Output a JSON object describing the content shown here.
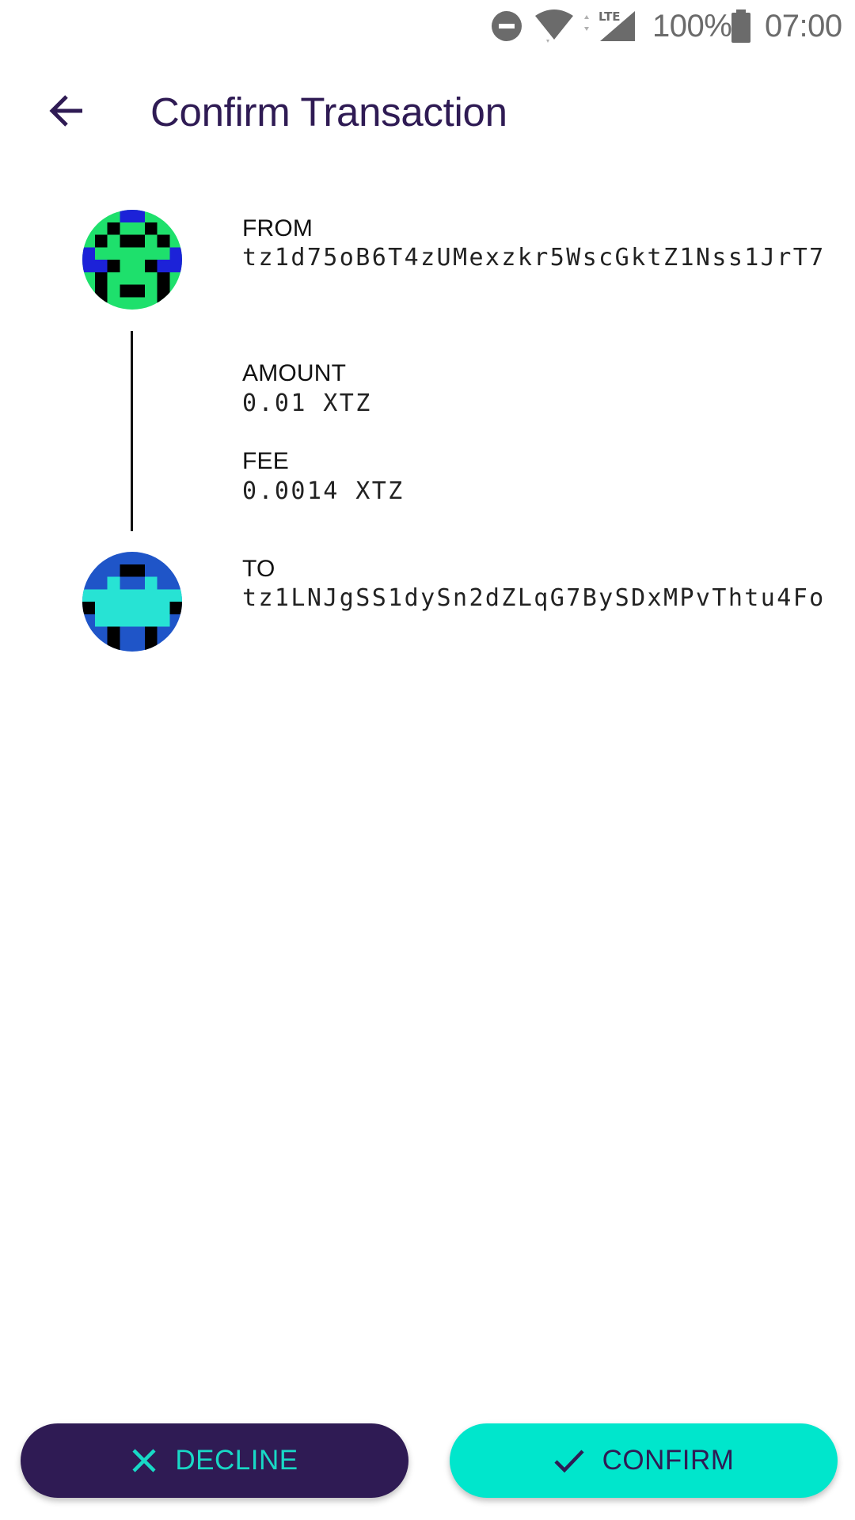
{
  "status_bar": {
    "battery_percent": "100%",
    "time": "07:00",
    "network_type": "LTE",
    "icons": [
      "do-not-disturb-icon",
      "wifi-icon",
      "lte-signal-icon",
      "battery-icon"
    ]
  },
  "app_bar": {
    "title": "Confirm Transaction",
    "back_icon": "arrow-back-icon"
  },
  "transaction": {
    "from": {
      "label": "FROM",
      "address": "tz1d75oB6T4zUMexzkr5WscGktZ1Nss1JrT7",
      "avatar_colors": [
        "#1ee06c",
        "#1c22d8",
        "#000000"
      ]
    },
    "amount": {
      "label": "AMOUNT",
      "value": "0.01 XTZ"
    },
    "fee": {
      "label": "FEE",
      "value": "0.0014 XTZ"
    },
    "to": {
      "label": "TO",
      "address": "tz1LNJgSS1dySn2dZLqG7BySDxMPvThtu4Fo",
      "avatar_colors": [
        "#1f55c8",
        "#27e3d4",
        "#000000"
      ]
    }
  },
  "actions": {
    "decline_label": "DECLINE",
    "confirm_label": "CONFIRM",
    "decline_icon": "close-icon",
    "confirm_icon": "check-icon"
  },
  "colors": {
    "primary": "#2f1b54",
    "accent": "#00e6cc"
  }
}
